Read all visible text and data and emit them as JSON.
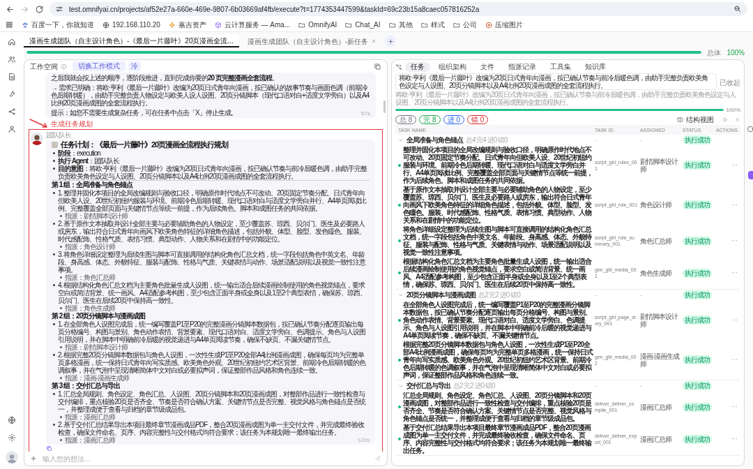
{
  "browser": {
    "url": "test.omnifyai.cn/projects/af52e27a-660e-469e-9807-6b03669af4fb/execute?t=1774353447599&taskId=69c23b15a8caec057816252a",
    "bookmarks": [
      {
        "label": "百度一下，你就知道",
        "kind": "paw"
      },
      {
        "label": "192.168.110.20",
        "kind": "globe"
      },
      {
        "label": "嘉吉资产",
        "kind": "spark"
      },
      {
        "label": "云计算服务 — Ama...",
        "kind": "cube"
      },
      {
        "label": "OmnifyAI",
        "kind": "folder"
      },
      {
        "label": "Chat_AI",
        "kind": "folder"
      },
      {
        "label": "其他",
        "kind": "folder"
      },
      {
        "label": "样式",
        "kind": "folder"
      },
      {
        "label": "公司",
        "kind": "folder"
      },
      {
        "label": "压缩图片",
        "kind": "disc"
      }
    ]
  },
  "app_tabs": [
    {
      "label": "漫画生成团队（自主设计角色）-《最后一片藤叶》20页漫画全流...",
      "selected": true,
      "closable": false
    },
    {
      "label": "漫画生成团队（自主设计角色）-新任务",
      "selected": false,
      "closable": true
    }
  ],
  "overall_progress": {
    "label": "总体",
    "reading": "100%",
    "level": 1
  },
  "workspace": {
    "title": "工作空间",
    "mode_button": "切换工作模式",
    "mode_tag": "泠",
    "messages": [
      {
        "paragraphs": [
          "之后我就会按上述的顺序，逐阶段推进，直到完成你要的**20 页完整漫画全套流程**。",
          "→ 需求已明确：将欧·亨利《最后一片藤叶》改编为20页日式青年向漫画，按已确认的故事节奏与画面色调（前期冷色后期转暖），由助手完整负责人物设定与欧美人设人设图、20页分镜脚本（现代口语对白+适度文学旁白）以及A4比例20页漫画成图的全套流程执行。",
          "提示：如您不需要生成复杂任务，可在任务中点击「X」停止生成。"
        ],
        "time": "57s"
      }
    ],
    "annotation": "生成任务规划",
    "plan": {
      "sender": "团队队长",
      "title": "任务计划：《最后一片藤叶》20页漫画全流程执行规划",
      "meta": [
        "**阶段**：execution",
        "**执行 Agent**：团队队长",
        "**目的意图**：将欧·亨利《最后一片藤叶》改编为20页日式青年向漫画，按已确认节奏与前冷后暖色调，由助手完整负责欧美角色设定与人设图、20页分镜脚本以及A4比例20页漫画成图的全套流程执行。"
      ],
      "groups": [
        {
          "heading": "第 1 组：全局准备与角色锚点",
          "items": [
            {
              "text": "1. 整理并固化本项目的全局改编规则与验收口径，明确原作时代地点不可改动、20页固定节奏分配、日式青年向但欧美人设、20世纪初纽约服装与环境、前期冷色后期转暖、现代口语对白与适度文学旁白并行、A4单页阅读比例、完整覆盖全部页面与关键情节点等统一前提，作为后续角色、脚本和成图任务的共同依据。",
              "assignee": "指派：剧情脚本设计师"
            },
            {
              "text": "2. 基于原作文本抽取并设计全部主要与必要辅助角色的人物设定，至少覆盖苏、琼西、贝尔门、医生及必要路人或房东，输出符合日式青年向画风下欧美角色特征的详细角色描述，包括外貌、体型、脸型、发色瞳色、服装、时代感配饰、性格气质、表情习惯、典型动作、人物关系和在剧情中的功能定位。",
              "assignee": "指派：角色设计师"
            },
            {
              "text": "3. 将角色详细设定整理为后续生图与脚本可直接调用的结构化角色汇总文档，统一字段包括角色中英文名、年龄段、身高感、体态、外貌特征、服装与配饰、性格与气质、关键表情与动作、场景适配说明以及视觉一致性注意事项。",
              "assignee": "指派：角色汇总师"
            },
            {
              "text": "4. 根据结构化角色汇总文档为主要角色批量生成人设图，统一输出适合后续漫画绘制使用的角色视觉锚点，要求空白或简洁背景、统一画风、A4适配参考构图，至少包含正面半身或全身以及1至2个典型表情，确保苏、琼西、贝尔门、医生在后续20页中保持高一致性。",
              "assignee": "指派：角色生成师"
            }
          ]
        },
        {
          "heading": "第 2 组：20页分镜脚本与漫画成图",
          "items": [
            {
              "text": "1. 在全部角色人设图完成后，统一编写覆盖P1至P20的完整漫画分镜脚本数据包，按已确认节奏分配逐页输出每页分格编号、构图与景别、角色动作表情、背景要素、现代口语对白、适度文学旁白、色调提示、角色与人设图引用说明，并在脚本中明确前冷后暖的视觉递进与A4单页阅读节奏，确保不缺页、不漏关键情节点。",
              "assignee": "指派：剧情脚本设计师"
            },
            {
              "text": "2. 根据完整20页分镜脚本数据包与角色人设图，一次性生成P1至P20全部A4比例漫画成图，确保每页均为完整单页多格漫画，统一保持日式青年向写实质感、欧美角色外观、20世纪初纽约艺术区背景、前期冷色后期转暖的色调叙事，并在气泡中呈现清晰简体中文对白或必要拟声词，保证整部作品风格和角色连续一致。",
              "assignee": "指派：漫画-漫画生成师"
            }
          ]
        },
        {
          "heading": "第 3 组：交付汇总与导出",
          "items": [
            {
              "text": "1. 汇总全局规则、角色设定、角色汇总、人设图、20页分镜脚本和20页漫画成图，对整部作品进行一致性检查与交付编排，重点核验20页是否齐全、节奏是否符合确认方案、关键情节点是否完整、视觉风格与角色锚点是否统一，并整理成便于查看与归档的章节级成品包。",
              "assignee": "指派：漫画汇总师"
            },
            {
              "text": "2. 基于交付汇总结果导出本项目最终章节漫画成品PDF，整合20页漫画成图为单一主交付文件，并完成最终验收检查，确保文件命名、页序、内容完整性与交付格式均符合要求；该任务为本规划唯一最终输出任务。",
              "assignee": "指派：漫画汇总师"
            }
          ]
        }
      ],
      "time": "120s"
    },
    "input": {
      "placeholder": "输入您的想法..."
    }
  },
  "task_panel": {
    "tabs": [
      {
        "label": "任务",
        "selected": true
      },
      {
        "label": "组织架构",
        "selected": false
      },
      {
        "label": "文件",
        "selected": false
      },
      {
        "label": "指派记录",
        "selected": false
      },
      {
        "label": "工具集",
        "selected": false
      },
      {
        "label": "知识库",
        "selected": false
      }
    ],
    "goal": "将欧·亨利《最后一片藤叶》改编为20页日式青年向漫画，按已确认节奏与前冷后暖色调，由助手完整负责欧美角色设定与人设图、20页分镜脚本以及A4比例20页漫画成图的全套流程执行。",
    "goal_toggle": "已收起",
    "goal_subtitle": "将欧·亨利《最后一片藤叶》改编为20页日式青年向漫画，按已确认节奏与前冷后暖色调，由助手完整负责欧美角色设定与人设图、20页分镜脚本以及A4比例20页漫画成图的全套流程执行。",
    "progress": {
      "level": 1,
      "reading": "100%"
    },
    "chips": [
      {
        "label": "总 8",
        "color": "#6b7280"
      },
      {
        "label": "完 8",
        "color": "#16a34a"
      },
      {
        "label": "进 0",
        "color": "#2563eb"
      },
      {
        "label": "错 0",
        "color": "#dc2626"
      }
    ],
    "view_button": "结构视图",
    "table": {
      "columns": [
        "TASK NAME",
        "TASK ID",
        "ASSIGNED",
        "STATUS",
        "ACTIONS"
      ],
      "groups": [
        {
          "name": "全局准备与角色锚点",
          "stats": "总4 完4 进0 错0",
          "task_id": "-",
          "assigned": "-",
          "status": "执行成功",
          "expanded": true,
          "tasks": [
            {
              "name": "整理并固化本项目的全局改编规则与验收口径，明确原作时代地点不可改动、20页固定节奏分配、日式青年向但欧美人设、20世纪初纽约服装与环境、前期冷色后期转暖、现代口语对白与适度文学旁白并行、A4单页阅读比例、完整覆盖全部页面与关键情节点等统一前提，作为后续角色、脚本和成图任务的共同依据。",
              "task_id": "script_gbl_rules_001",
              "assigned": "剧情脚本设计师",
              "status": "执行成功",
              "actions": "···"
            },
            {
              "name": "基于原作文本抽取并设计全部主要与必要辅助角色的人物设定，至少覆盖苏、琼西、贝尔门、医生及必要路人或房东，输出符合日式青年向画风下欧美角色特征的详细角色描述，包括外貌、体型、脸型、发色瞳色、服装、时代感配饰、性格气质、表情习惯、典型动作、人物关系和在剧情中的功能定位。",
              "task_id": "script_gbl_role_001",
              "assigned": "角色设计师",
              "status": "执行成功",
              "actions": "···"
            },
            {
              "name": "将角色详细设定整理为后续生图与脚本可直接调用的结构化角色汇总文档，统一字段包括角色中英文名、年龄段、身高感、体态、外貌特征、服装与配饰、性格与气质、关键表情与动作、场景适配说明以及视觉一致性注意事项。",
              "task_id": "script_gbl_role_summary_001",
              "assigned": "角色汇总师",
              "status": "执行成功",
              "actions": "···"
            },
            {
              "name": "根据结构化角色汇总文档为主要角色批量生成人设图，统一输出适合后续漫画绘制使用的角色视觉锚点，要求空白或简洁背景、统一画风、A4适配参考构图，至少包含正面半身或全身以及1至2个典型表情，确保苏、琼西、贝尔门、医生在后续20页中保持高一致性。",
              "task_id": "gen_gbl_media_001",
              "assigned": "角色生成师",
              "status": "执行成功",
              "actions": "···"
            }
          ]
        },
        {
          "name": "20页分镜脚本与漫画成图",
          "stats": "总2 完2 进0 错0",
          "task_id": "-",
          "assigned": "-",
          "status": "执行成功",
          "expanded": true,
          "tasks": [
            {
              "name": "在全部角色人设图完成后，统一编写覆盖P1至P20的完整漫画分镜脚本数据包，按已确认节奏分配逐页输出每页分格编号、构图与景别、角色动作表情、背景要素、现代口语对白、适度文学旁白、色调提示、角色与人设图引用说明，并在脚本中明确前冷后暖的视觉递进与A4单页阅读节奏，确保不缺页、不漏关键情节点。",
              "task_id": "script_gbl_page_story_001",
              "assigned": "剧情脚本设计师",
              "status": "执行成功",
              "actions": "···"
            },
            {
              "name": "根据完整20页分镜脚本数据包与角色人设图，一次性生成P1至P20全部A4比例漫画成图，确保每页均为完整单页多格漫画，统一保持日式青年向写实质感、欧美角色外观、20世纪初纽约艺术区背景、前期冷色后期转暖的色调叙事，并在气泡中呈现清晰简体中文对白或必要拟声词，保证整部作品风格和角色连续一致。",
              "task_id": "gen_gbl_media_002",
              "assigned": "漫画-漫画生成师",
              "status": "执行成功",
              "actions": "···"
            }
          ]
        },
        {
          "name": "交付汇总与导出",
          "stats": "总2 完2 进0 错0",
          "task_id": "-",
          "assigned": "-",
          "status": "执行成功",
          "expanded": true,
          "tasks": [
            {
              "name": "汇总全局规则、角色设定、角色汇总、人设图、20页分镜脚本和20页漫画成图，对整部作品进行一致性检查与交付编排，重点核验20页是否齐全、节奏是否符合确认方案、关键情节点是否完整、视觉风格与角色锚点是否统一，并整理成便于查看与归档的章节级成品包。",
              "task_id": "deliver_deliver_compile_001",
              "assigned": "漫画汇总师",
              "status": "执行成功",
              "actions": "···"
            },
            {
              "name": "基于交付汇总结果导出本项目最终章节漫画成品PDF，整合20页漫画成图为单一主交付文件，并完成最终验收检查，确保文件命名、页序、内容完整性与交付格式均符合要求；该任务为本规划唯一最终输出任务。",
              "task_id": "deliver_deliver_export_001",
              "assigned": "漫画汇总师",
              "status": "执行成功",
              "actions": "···"
            }
          ]
        }
      ]
    }
  }
}
